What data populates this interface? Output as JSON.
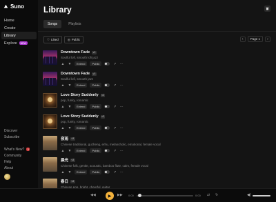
{
  "app": {
    "brand": "Suno"
  },
  "sidebar": {
    "items": [
      {
        "label": "Home",
        "active": false
      },
      {
        "label": "Create",
        "active": false
      },
      {
        "label": "Library",
        "active": true
      },
      {
        "label": "Explore",
        "active": false,
        "badge": "NEW"
      }
    ],
    "lower": [
      "Discover",
      "Subscribe"
    ],
    "bottom": [
      "What's New?",
      "Community",
      "Help",
      "About"
    ],
    "whats_new_count": "3"
  },
  "library": {
    "title": "Library",
    "tabs": [
      {
        "label": "Songs",
        "active": true
      },
      {
        "label": "Playlists",
        "active": false
      }
    ],
    "filters": [
      "Liked",
      "Public"
    ],
    "pager_label": "Page 1"
  },
  "songs": [
    {
      "title": "Downtown Fade",
      "version": "v3",
      "desc": "Soulful lofi, smooth lofi jazz",
      "thumb": "city",
      "tag": "Extend",
      "visibility": "Public"
    },
    {
      "title": "Downtown Fade",
      "version": "v3",
      "desc": "Soulful lofi, smooth jazz",
      "thumb": "city",
      "tag": "Extend",
      "visibility": "Public"
    },
    {
      "title": "Love Story Suddenly",
      "version": "v3",
      "desc": "pop, funky, romantic",
      "thumb": "portrait",
      "tag": "Extend",
      "visibility": "Public"
    },
    {
      "title": "Love Story Suddenly",
      "version": "v3",
      "desc": "pop, funky, romantic",
      "thumb": "portrait",
      "tag": "Extend",
      "visibility": "Public"
    },
    {
      "title": "夜雨",
      "version": "v3",
      "desc": "Chinese traditional, guzheng, erhu, melancholic, emotional, female vocal",
      "thumb": "scene",
      "tag": "Extend",
      "visibility": "Public"
    },
    {
      "title": "晨光",
      "version": "v3",
      "desc": "Chinese folk, gentle, acoustic, bamboo flute, calm, female vocal",
      "thumb": "scene",
      "tag": "Extend",
      "visibility": "Public"
    },
    {
      "title": "春日",
      "version": "v3",
      "desc": "Chinese pop, bright, cheerful, guitar",
      "thumb": "scene",
      "tag": "Extend",
      "visibility": "Public"
    }
  ],
  "player": {
    "elapsed": "0:00",
    "duration": "0:00",
    "progress": 0.0,
    "volume": 1.0
  },
  "colors": {
    "accent": "#f4b23c",
    "badge_new": "#b03ad6",
    "badge_count": "#d23a3a"
  }
}
